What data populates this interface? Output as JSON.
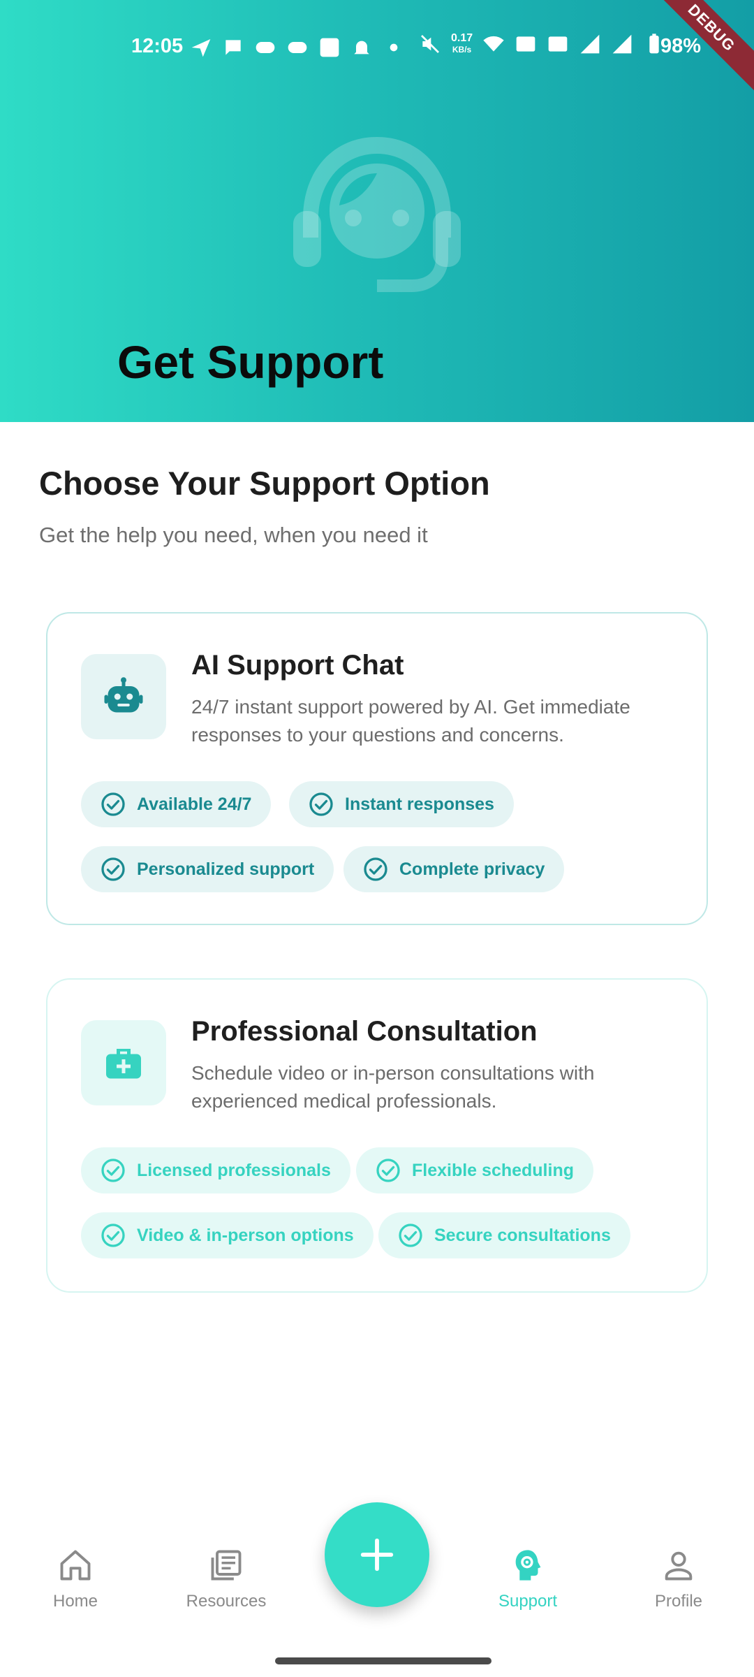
{
  "status_bar": {
    "time": "12:05",
    "speed_value": "0.17",
    "speed_unit": "KB/s",
    "battery": "98%",
    "debug_label": "DEBUG"
  },
  "header": {
    "title": "Get Support",
    "illustration": "headset-support-icon"
  },
  "intro": {
    "title": "Choose Your Support Option",
    "subtitle": "Get the help you need, when you need it"
  },
  "cards": [
    {
      "icon": "robot-icon",
      "title": "AI Support Chat",
      "description": "24/7 instant support powered by AI. Get immediate responses to your questions and concerns.",
      "features": [
        "Available 24/7",
        "Instant responses",
        "Personalized support",
        "Complete privacy"
      ],
      "accent": "#1a8a90"
    },
    {
      "icon": "medical-kit-icon",
      "title": "Professional Consultation",
      "description": "Schedule video or in-person consultations with experienced medical professionals.",
      "features": [
        "Licensed professionals",
        "Flexible scheduling",
        "Video & in-person options",
        "Secure consultations"
      ],
      "accent": "#36d3c0"
    }
  ],
  "bottom_nav": {
    "items": [
      {
        "label": "Home",
        "icon": "home-icon"
      },
      {
        "label": "Resources",
        "icon": "resources-icon"
      },
      {
        "label": "Support",
        "icon": "support-icon",
        "active": true
      },
      {
        "label": "Profile",
        "icon": "profile-icon"
      }
    ],
    "fab_icon": "plus-icon"
  },
  "colors": {
    "header_gradient_start": "#2fdcc6",
    "header_gradient_end": "#139ea6",
    "active": "#34d3c2"
  }
}
